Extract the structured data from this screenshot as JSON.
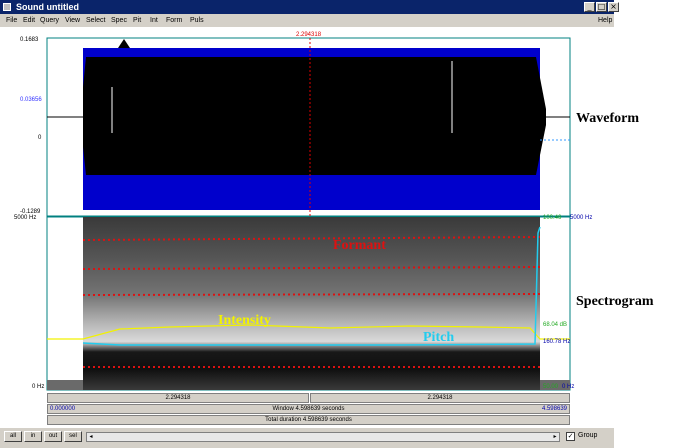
{
  "window": {
    "title": "Sound untitled",
    "minimize_glyph": "_",
    "maximize_glyph": "□",
    "close_glyph": "×"
  },
  "menus": [
    "File",
    "Edit",
    "Query",
    "View",
    "Select",
    "Spec",
    "Pit",
    "Int",
    "Form",
    "Puls"
  ],
  "help_label": "Help",
  "cursor_time": "2.294318",
  "waveform": {
    "y_max": "0.1683",
    "y_cursor": "0.03656",
    "y_zero": "0",
    "y_min": "-0.1289"
  },
  "spectrogram": {
    "freq_max": "5000 Hz",
    "freq_min": "0 Hz",
    "right_freq_max": "5000 Hz",
    "right_freq_min": "0 Hz",
    "intensity_max": "100.46",
    "intensity_cur": "68.04 dB",
    "intensity_min": "50.00",
    "pitch_cur": "160.78 Hz"
  },
  "overlay_labels": {
    "formant": "Formant",
    "intensity": "Intensity",
    "pitch": "Pitch"
  },
  "annotations": {
    "waveform": "Waveform",
    "spectrogram": "Spectrogram"
  },
  "time_bars": {
    "left_segment": "2.294318",
    "right_segment": "2.294318",
    "window_start": "0.000000",
    "window_label": "Window 4.598639 seconds",
    "window_end": "4.598639",
    "total_label": "Total duration 4.598639 seconds"
  },
  "buttons": {
    "all": "all",
    "in": "in",
    "out": "out",
    "sel": "sel"
  },
  "group": {
    "label": "Group",
    "checked": true,
    "check_glyph": "✓"
  },
  "colors": {
    "waveform_fill": "#0000cc",
    "waveform_core": "#000000",
    "formant": "#dd1111",
    "intensity": "#f2f200",
    "pitch": "#22ccee",
    "cursor": "#dd0000",
    "frame": "#008080"
  }
}
